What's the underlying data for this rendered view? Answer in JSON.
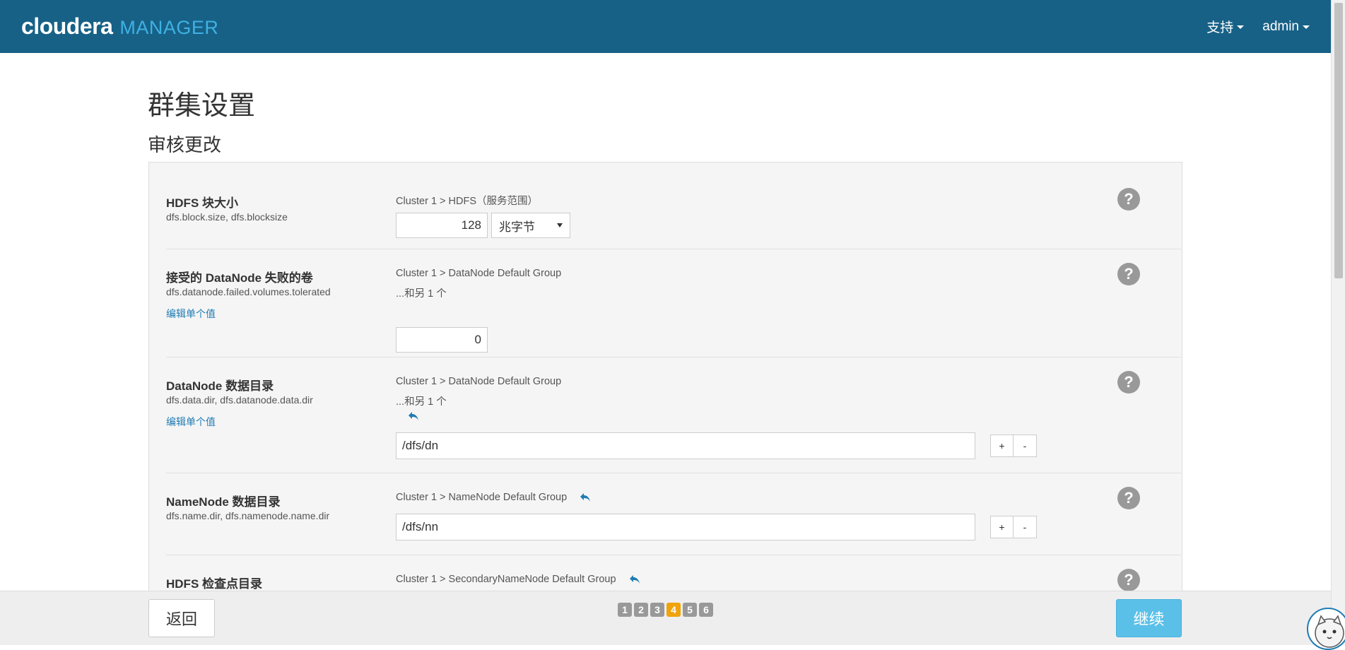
{
  "header": {
    "brand_primary": "cloudera",
    "brand_secondary": "MANAGER",
    "menus": [
      {
        "label": "支持"
      },
      {
        "label": "admin"
      }
    ]
  },
  "page": {
    "title": "群集设置",
    "section_title": "审核更改"
  },
  "properties": [
    {
      "name": "HDFS 块大小",
      "key": "dfs.block.size, dfs.blocksize",
      "scope": "Cluster 1 > HDFS（服务范围）",
      "value": "128",
      "unit": "兆字节"
    },
    {
      "name": "接受的 DataNode 失败的卷",
      "key": "dfs.datanode.failed.volumes.tolerated",
      "edit_label": "编辑单个值",
      "scope": "Cluster 1 > DataNode Default Group",
      "more": "...和另 1 个",
      "value": "0"
    },
    {
      "name": "DataNode 数据目录",
      "key": "dfs.data.dir, dfs.datanode.data.dir",
      "edit_label": "编辑单个值",
      "scope": "Cluster 1 > DataNode Default Group",
      "more": "...和另 1 个",
      "value": "/dfs/dn",
      "add_label": "+",
      "remove_label": "-"
    },
    {
      "name": "NameNode 数据目录",
      "key": "dfs.name.dir, dfs.namenode.name.dir",
      "scope": "Cluster 1 > NameNode Default Group",
      "value": "/dfs/nn",
      "add_label": "+",
      "remove_label": "-"
    },
    {
      "name": "HDFS 检查点目录",
      "scope": "Cluster 1 > SecondaryNameNode Default Group"
    }
  ],
  "help_glyph": "?",
  "footer": {
    "back_label": "返回",
    "continue_label": "继续",
    "steps": [
      "1",
      "2",
      "3",
      "4",
      "5",
      "6"
    ],
    "active_step": 4
  },
  "colors": {
    "header_bg": "#176187",
    "brand_accent": "#3fb1e3",
    "link": "#1f7cb3",
    "active_step": "#f0a30a",
    "continue_bg": "#5bc0e8"
  },
  "icons": {
    "undo": "undo-arrow-icon",
    "help": "help-question-icon",
    "caret": "caret-down-icon"
  }
}
